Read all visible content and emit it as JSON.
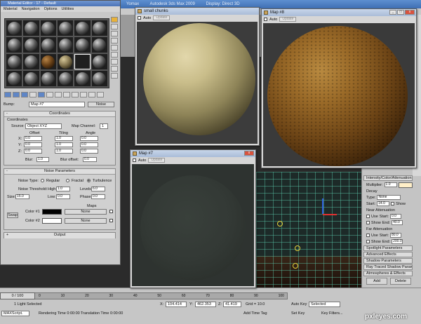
{
  "app": {
    "title_parts": [
      "Yomax",
      "Autodesk 3ds Max 2009",
      "Display: Direct 3D"
    ],
    "colors": {
      "titlebar": "#4c74b8",
      "viewport_grid": "#5ac8aa"
    }
  },
  "material_editor": {
    "title": "Material Editor - 17 - Default",
    "menu": [
      "Material",
      "Navigation",
      "Options",
      "Utilities"
    ],
    "bump_label": "Bump:",
    "map_name": "Map #7",
    "type_button": "Noise",
    "coordinates": {
      "header": "Coordinates",
      "group_label": "Coordinates",
      "source_label": "Source:",
      "source_value": "Object XYZ",
      "map_channel_label": "Map Channel:",
      "map_channel_value": "1",
      "col_offset": "Offset",
      "col_tiling": "Tiling",
      "col_angle": "Angle",
      "rows": [
        {
          "axis": "X:",
          "offset": "0.0",
          "tiling": "1.0",
          "angle": "0.0"
        },
        {
          "axis": "Y:",
          "offset": "0.0",
          "tiling": "1.0",
          "angle": "0.0"
        },
        {
          "axis": "Z:",
          "offset": "0.0",
          "tiling": "1.0",
          "angle": "0.0"
        }
      ],
      "blur_label": "Blur:",
      "blur_value": "1.0",
      "blur_offset_label": "Blur offset:",
      "blur_offset_value": "0.0"
    },
    "noise": {
      "header": "Noise Parameters",
      "type_label": "Noise Type:",
      "types": [
        "Regular",
        "Fractal",
        "Turbulence"
      ],
      "selected_type": "Turbulence",
      "threshold_label": "Noise Threshold:",
      "high_label": "High:",
      "high_value": "1.0",
      "levels_label": "Levels:",
      "levels_value": "6.0",
      "low_label": "Low:",
      "low_value": "0.0",
      "phase_label": "Phase:",
      "phase_value": "0.0",
      "size_label": "Size:",
      "size_value": "15.0",
      "maps_label": "Maps",
      "swap_label": "Swap",
      "color1_label": "Color #1",
      "color1_hex": "#000000",
      "color2_label": "Color #2",
      "color2_hex": "#ffffff",
      "none1": "None",
      "none2": "None"
    },
    "output_header": "Output"
  },
  "windows": {
    "small_chunks": {
      "title": "small chunks",
      "auto_label": "Auto",
      "update_label": "Update"
    },
    "map8": {
      "title": "Map #8",
      "auto_label": "Auto",
      "update_label": "Update"
    },
    "map7": {
      "title": "Map #7",
      "auto_label": "Auto",
      "update_label": "Update"
    }
  },
  "command_panel": {
    "intensity_header": "Intensity/Color/Attenuation",
    "multiplier_label": "Multiplier:",
    "multiplier_value": "1.0",
    "decay_label": "Decay",
    "decay_type_label": "Type:",
    "decay_type_value": "None",
    "start_label": "Start:",
    "start_value": "14.0",
    "show_label": "Show",
    "near_header": "Near Attenuation",
    "near_use": "Use",
    "near_start_label": "Start:",
    "near_start_value": "0.0",
    "near_show": "Show",
    "near_end_label": "End:",
    "near_end_value": "40.0",
    "far_header": "Far Attenuation",
    "far_use": "Use",
    "far_start_label": "Start:",
    "far_start_value": "80.0",
    "far_show": "Show",
    "far_end_label": "End:",
    "far_end_value": "200.0",
    "rollouts": [
      "Spotlight Parameters",
      "Advanced Effects",
      "Shadow Parameters",
      "Ray Traced Shadow Params",
      "Atmospheres & Effects"
    ],
    "add_label": "Add",
    "delete_label": "Delete"
  },
  "statusbar": {
    "time_slider": "0 / 100",
    "ticks": [
      "0",
      "10",
      "20",
      "30",
      "40",
      "50",
      "60",
      "70",
      "80",
      "90",
      "100"
    ],
    "selection": "1 Light Selected",
    "rendering_time": "Rendering Time  0:00:00",
    "translation_time": "Translation Time  0:00:00",
    "x_label": "X:",
    "x_value": "104.414",
    "y_label": "Y:",
    "y_value": "462.353",
    "z_label": "Z:",
    "z_value": "41.419",
    "grid": "Grid = 10.0",
    "add_time_tag": "Add Time Tag",
    "auto_key": "Auto Key",
    "selected": "Selected",
    "set_key": "Set Key",
    "key_filters": "Key Filters...",
    "maxscript": "MAXScript."
  },
  "watermark": "pxleyes.com"
}
